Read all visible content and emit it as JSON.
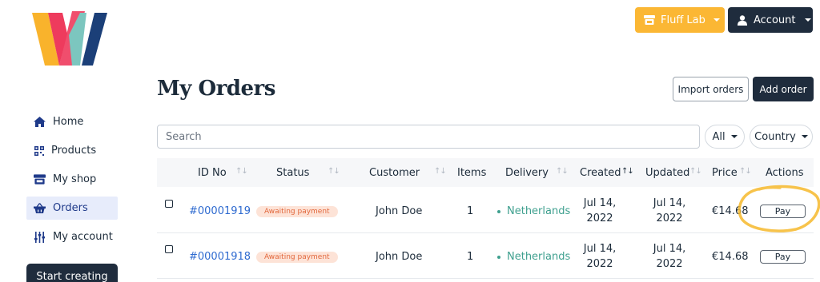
{
  "brand": {
    "logo_colors": [
      "#f9b32c",
      "#ee3b5d",
      "#7cc6bf",
      "#1b3f78"
    ]
  },
  "header": {
    "shop_button": {
      "label": "Fluff Lab",
      "icon": "store-icon",
      "color": "#fbb734"
    },
    "account_button": {
      "label": "Account",
      "icon": "user-icon",
      "color": "#1f2c3d"
    }
  },
  "sidebar": {
    "items": [
      {
        "label": "Home",
        "icon": "home-icon",
        "active": false
      },
      {
        "label": "Products",
        "icon": "qr-grid-icon",
        "active": false
      },
      {
        "label": "My shop",
        "icon": "store-icon",
        "active": false
      },
      {
        "label": "Orders",
        "icon": "basket-icon",
        "active": true
      },
      {
        "label": "My account",
        "icon": "sliders-icon",
        "active": false
      }
    ],
    "cta_label": "Start creating"
  },
  "main": {
    "title": "My Orders",
    "import_label": "Import orders",
    "add_label": "Add order",
    "search_placeholder": "Search",
    "filter_all": "All",
    "filter_country": "Country"
  },
  "table": {
    "columns": [
      "ID No",
      "Status",
      "Customer",
      "Items",
      "Delivery",
      "Created",
      "Updated",
      "Price",
      "Actions"
    ],
    "rows": [
      {
        "id": "#00001919",
        "status": "Awaiting payment",
        "customer": "John Doe",
        "items": "1",
        "delivery": "Netherlands",
        "created": [
          "Jul 14,",
          "2022"
        ],
        "updated": [
          "Jul 14,",
          "2022"
        ],
        "price": "€14.68",
        "action": "Pay"
      },
      {
        "id": "#00001918",
        "status": "Awaiting payment",
        "customer": "John Doe",
        "items": "1",
        "delivery": "Netherlands",
        "created": [
          "Jul 14,",
          "2022"
        ],
        "updated": [
          "Jul 14,",
          "2022"
        ],
        "price": "€14.68",
        "action": "Pay"
      }
    ]
  },
  "colors": {
    "link": "#2f6bd0",
    "status_badge_bg": "#fde3d7",
    "status_badge_text": "#e2683d",
    "delivery": "#3fa08f",
    "highlight_circle": "#f6b82c"
  }
}
